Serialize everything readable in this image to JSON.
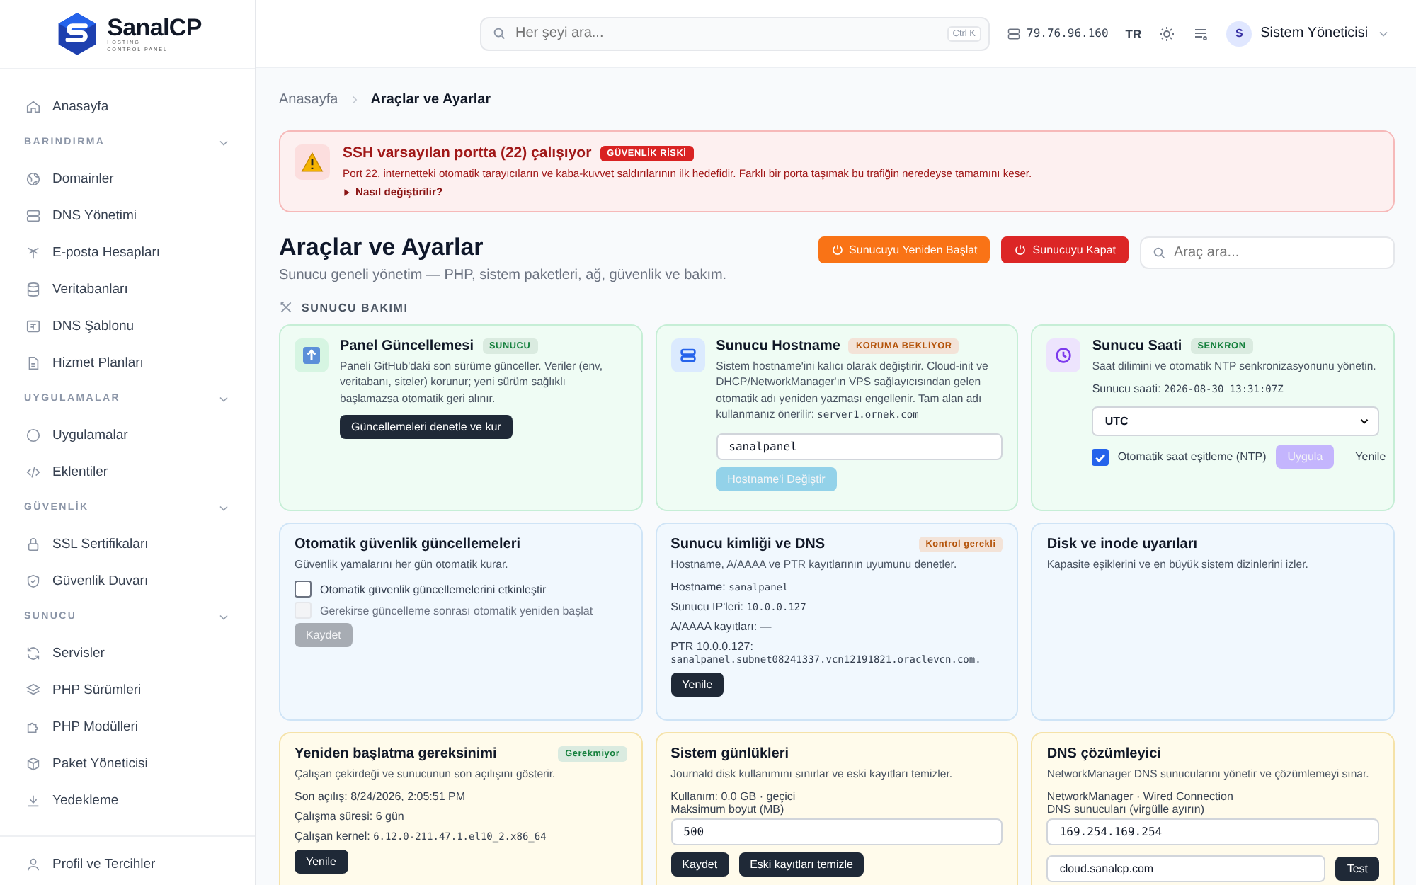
{
  "sidebar": {
    "logo": {
      "name": "SanalCP",
      "tagline_1": "HOSTING",
      "tagline_2": "CONTROL PANEL"
    },
    "home": {
      "label": "Anasayfa"
    },
    "sections": [
      {
        "title": "BARINDIRMA",
        "expanded": true,
        "items": [
          {
            "label": "Domainler"
          },
          {
            "label": "DNS Yönetimi"
          },
          {
            "label": "E-posta Hesapları"
          },
          {
            "label": "Veritabanları"
          },
          {
            "label": "DNS Şablonu"
          },
          {
            "label": "Hizmet Planları"
          }
        ]
      },
      {
        "title": "UYGULAMALAR",
        "expanded": true,
        "items": [
          {
            "label": "Uygulamalar"
          },
          {
            "label": "Eklentiler"
          }
        ]
      },
      {
        "title": "GÜVENLİK",
        "expanded": true,
        "items": [
          {
            "label": "SSL Sertifikaları"
          },
          {
            "label": "Güvenlik Duvarı"
          }
        ]
      },
      {
        "title": "SUNUCU",
        "expanded": true,
        "items": [
          {
            "label": "Servisler"
          },
          {
            "label": "PHP Sürümleri"
          },
          {
            "label": "PHP Modülleri"
          },
          {
            "label": "Paket Yöneticisi"
          },
          {
            "label": "Yedekleme"
          }
        ]
      }
    ],
    "footer": {
      "label": "Profil ve Tercihler"
    }
  },
  "header": {
    "search": {
      "placeholder": "Her şeyi ara...",
      "shortcut": "Ctrl K"
    },
    "ip": "79.76.96.160",
    "language": "TR",
    "user": {
      "initial": "S",
      "name": "Sistem Yöneticisi"
    }
  },
  "breadcrumb": [
    {
      "label": "Anasayfa"
    },
    {
      "label": "Araçlar ve Ayarlar"
    }
  ],
  "alert": {
    "title": "SSH varsayılan portta (22) çalışıyor",
    "badge": "GÜVENLİK RİSKİ",
    "text": "Port 22, internetteki otomatik tarayıcıların ve kaba-kuvvet saldırılarının ilk hedefidir. Farklı bir porta taşımak bu trafiğin neredeyse tamamını keser.",
    "link": "Nasıl değiştirilir?"
  },
  "page": {
    "title": "Araçlar ve Ayarlar",
    "subtitle": "Sunucu geneli yönetim — PHP, sistem paketleri, ağ, güvenlik ve bakım.",
    "actions": [
      {
        "label": "Sunucuyu Yeniden Başlat",
        "color": "#f97316"
      },
      {
        "label": "Sunucuyu Kapat",
        "color": "#dc2626"
      }
    ],
    "search": {
      "placeholder": "Araç ara..."
    }
  },
  "section": {
    "title": "SUNUCU BAKIMI"
  },
  "cards": [
    {
      "title": "Panel Güncellemesi",
      "badge": {
        "text": "SUNUCU",
        "color": "#15803d"
      },
      "description": {
        "text": "Paneli GitHub'daki son sürüme günceller. Veriler (env, veritabanı, siteler) korunur; yeni sürüm sağlıklı başlamazsa otomatik geri alınır."
      },
      "blocks": [
        {
          "kind": "button",
          "label": "Güncellemeleri denetle ve kur",
          "color": "#1f2937",
          "disabled": false
        }
      ]
    },
    {
      "title": "Sunucu Hostname",
      "badge": {
        "text": "KORUMA BEKLİYOR",
        "color": "#b45309"
      },
      "description": {
        "text": "Sistem hostname'ini kalıcı olarak değiştirir. Cloud-init ve DHCP/NetworkManager'ın VPS sağlayıcısından gelen otomatik adı yeniden yazması engellenir. Tam alan adı kullanmanız önerilir:",
        "code": "server1.ornek.com"
      },
      "blocks": [
        {
          "kind": "field",
          "value": "sanalpanel"
        },
        {
          "kind": "button",
          "label": "Hostname'i Değiştir",
          "color": "#93d2e9",
          "disabled": true
        }
      ]
    },
    {
      "title": "Sunucu Saati",
      "badge": {
        "text": "SENKRON",
        "color": "#15803d"
      },
      "description": {
        "text": "Saat dilimini ve otomatik NTP senkronizasyonunu yönetin."
      },
      "blocks": [
        {
          "kind": "kv",
          "label": "Sunucu saati:",
          "value": "2026-08-30 13:31:07Z",
          "wrap": false
        },
        {
          "kind": "select",
          "value": "UTC"
        },
        {
          "kind": "row",
          "items": [
            {
              "kind": "checkbox",
              "label": "Otomatik saat eşitleme (NTP)",
              "checked": true,
              "disabled": false
            },
            {
              "kind": "button",
              "label": "Uygula",
              "color": "#c4b5fd",
              "disabled": true
            },
            {
              "kind": "link",
              "label": "Yenile"
            }
          ]
        }
      ]
    },
    {
      "title": "Otomatik güvenlik güncellemeleri",
      "description": {
        "text": "Güvenlik yamalarını her gün otomatik kurar."
      },
      "blocks": [
        {
          "kind": "checkbox",
          "label": "Otomatik güvenlik güncellemelerini etkinleştir",
          "checked": false,
          "disabled": false
        },
        {
          "kind": "checkbox",
          "label": "Gerekirse güncelleme sonrası otomatik yeniden başlat",
          "checked": false,
          "disabled": true
        },
        {
          "kind": "button",
          "label": "Kaydet",
          "color": "#a7acb3",
          "disabled": true
        }
      ]
    },
    {
      "title": "Sunucu kimliği ve DNS",
      "badge": {
        "text": "Kontrol gerekli",
        "color": "#b45309"
      },
      "description": {
        "text": "Hostname, A/AAAA ve PTR kayıtlarının uyumunu denetler."
      },
      "blocks": [
        {
          "kind": "kv",
          "label": "Hostname:",
          "value": "sanalpanel",
          "wrap": false
        },
        {
          "kind": "kv",
          "label": "Sunucu IP'leri:",
          "value": "10.0.0.127",
          "wrap": false
        },
        {
          "kind": "line",
          "text": "A/AAAA kayıtları: —"
        },
        {
          "kind": "kv",
          "label": "PTR 10.0.0.127:",
          "value": "sanalpanel.subnet08241337.vcn12191821.oraclevcn.com.",
          "wrap": true
        },
        {
          "kind": "button",
          "label": "Yenile",
          "color": "#1f2937",
          "disabled": false
        }
      ]
    },
    {
      "title": "Disk ve inode uyarıları",
      "description": {
        "text": "Kapasite eşiklerini ve en büyük sistem dizinlerini izler."
      }
    },
    {
      "title": "Yeniden başlatma gereksinimi",
      "badge": {
        "text": "Gerekmiyor",
        "color": "#15803d"
      },
      "description": {
        "text": "Çalışan çekirdeği ve sunucunun son açılışını gösterir."
      },
      "blocks": [
        {
          "kind": "line",
          "text": "Son açılış: 8/24/2026, 2:05:51 PM"
        },
        {
          "kind": "line",
          "text": "Çalışma süresi: 6 gün"
        },
        {
          "kind": "kv",
          "label": "Çalışan kernel:",
          "value": "6.12.0-211.47.1.el10_2.x86_64",
          "wrap": false
        },
        {
          "kind": "button",
          "label": "Yenile",
          "color": "#1f2937",
          "disabled": false
        }
      ]
    },
    {
      "title": "Sistem günlükleri",
      "description": {
        "text": "Journald disk kullanımını sınırlar ve eski kayıtları temizler."
      },
      "blocks": [
        {
          "kind": "label",
          "text": "Kullanım: 0.0 GB · geçici"
        },
        {
          "kind": "label",
          "text": "Maksimum boyut (MB)"
        },
        {
          "kind": "field",
          "value": "500"
        },
        {
          "kind": "row",
          "items": [
            {
              "kind": "button",
              "label": "Kaydet",
              "color": "#1f2937",
              "disabled": false
            },
            {
              "kind": "button",
              "label": "Eski kayıtları temizle",
              "color": "#1f2937",
              "disabled": false
            }
          ]
        }
      ]
    },
    {
      "title": "DNS çözümleyici",
      "description": {
        "text": "NetworkManager DNS sunucularını yönetir ve çözümlemeyi sınar."
      },
      "blocks": [
        {
          "kind": "label",
          "text": "NetworkManager · Wired Connection"
        },
        {
          "kind": "label",
          "text": "DNS sunucuları (virgülle ayırın)"
        },
        {
          "kind": "field",
          "value": "169.254.169.254"
        },
        {
          "kind": "row",
          "items": [
            {
              "kind": "field",
              "value": "cloud.sanalcp.com"
            },
            {
              "kind": "button",
              "label": "Test",
              "color": "#1f2937",
              "disabled": false
            }
          ]
        }
      ]
    }
  ]
}
